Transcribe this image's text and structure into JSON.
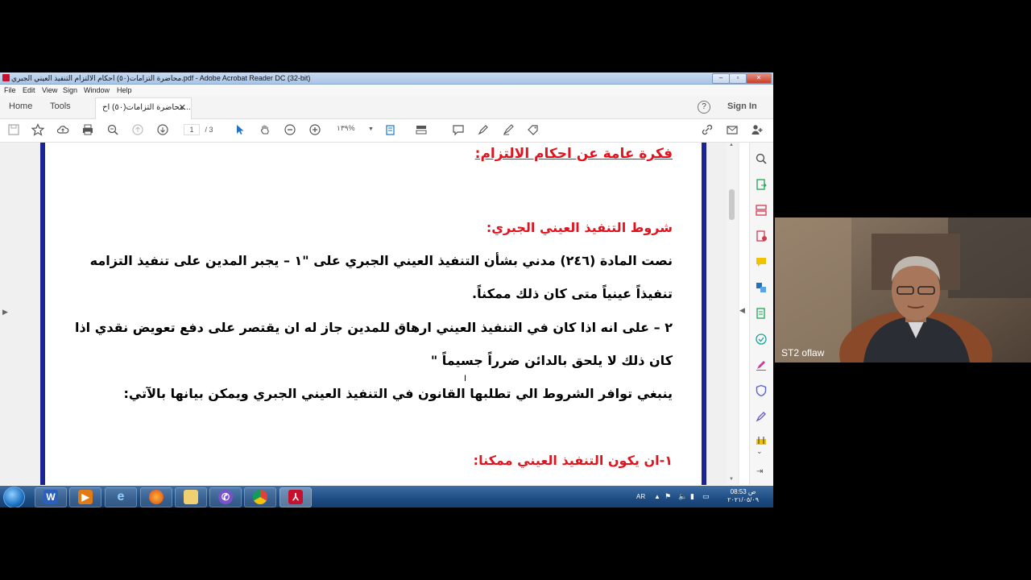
{
  "window": {
    "title": "محاضرة التزامات(٥٠) احكام الالتزام التنفيذ العيني الجبري.pdf - Adobe Acrobat Reader DC (32-bit)",
    "controls": [
      "–",
      "▫",
      "✕"
    ]
  },
  "menu": [
    "File",
    "Edit",
    "View",
    "Sign",
    "Window",
    "Help"
  ],
  "tabs": {
    "home": "Home",
    "tools": "Tools",
    "document": "محاضرة التزامات(٥٠) اح...",
    "help": "?",
    "sign_in": "Sign In"
  },
  "toolbar": {
    "page_current": "1",
    "page_total": "/ 3",
    "zoom": "١٣٩%"
  },
  "document": {
    "heading": "فكرة عامة عن احكام الالتزام:",
    "subheading": "شروط التنفيذ العيني الجبري:",
    "lines": [
      "نصت المادة (٢٤٦) مدني بشأن التنفيذ العيني الجبري على \"١ – يجبر المدين على تنفيذ التزامه",
      "تنفيذاً عينياً متى كان ذلك ممكناً.",
      "٢ – على انه اذا كان في التنفيذ العيني ارهاق للمدين جاز له ان يقتصر على دفع تعويض نقدي اذا",
      "كان ذلك لا يلحق بالدائن ضرراً جسيماً \"",
      "ينبغي توافر الشروط الي تطلبها القانون في التنفيذ العيني الجبري ويمكن بيانها بالآتي:"
    ],
    "section1": "١-ان يكون التنفيذ العيني ممكنا:"
  },
  "taskbar": {
    "apps": [
      "word",
      "media-player",
      "internet-explorer",
      "firefox",
      "file-explorer",
      "viber",
      "chrome",
      "acrobat-reader"
    ],
    "language": "AR",
    "time": "08:53 ص",
    "date": "٢٠٢١/٠٥/٠٩"
  },
  "video": {
    "participant_name": "ST2 oflaw"
  },
  "colors": {
    "heading_red": "#e0141e",
    "page_border_blue": "#1c2494",
    "taskbar_blue": "#1d4c82"
  }
}
